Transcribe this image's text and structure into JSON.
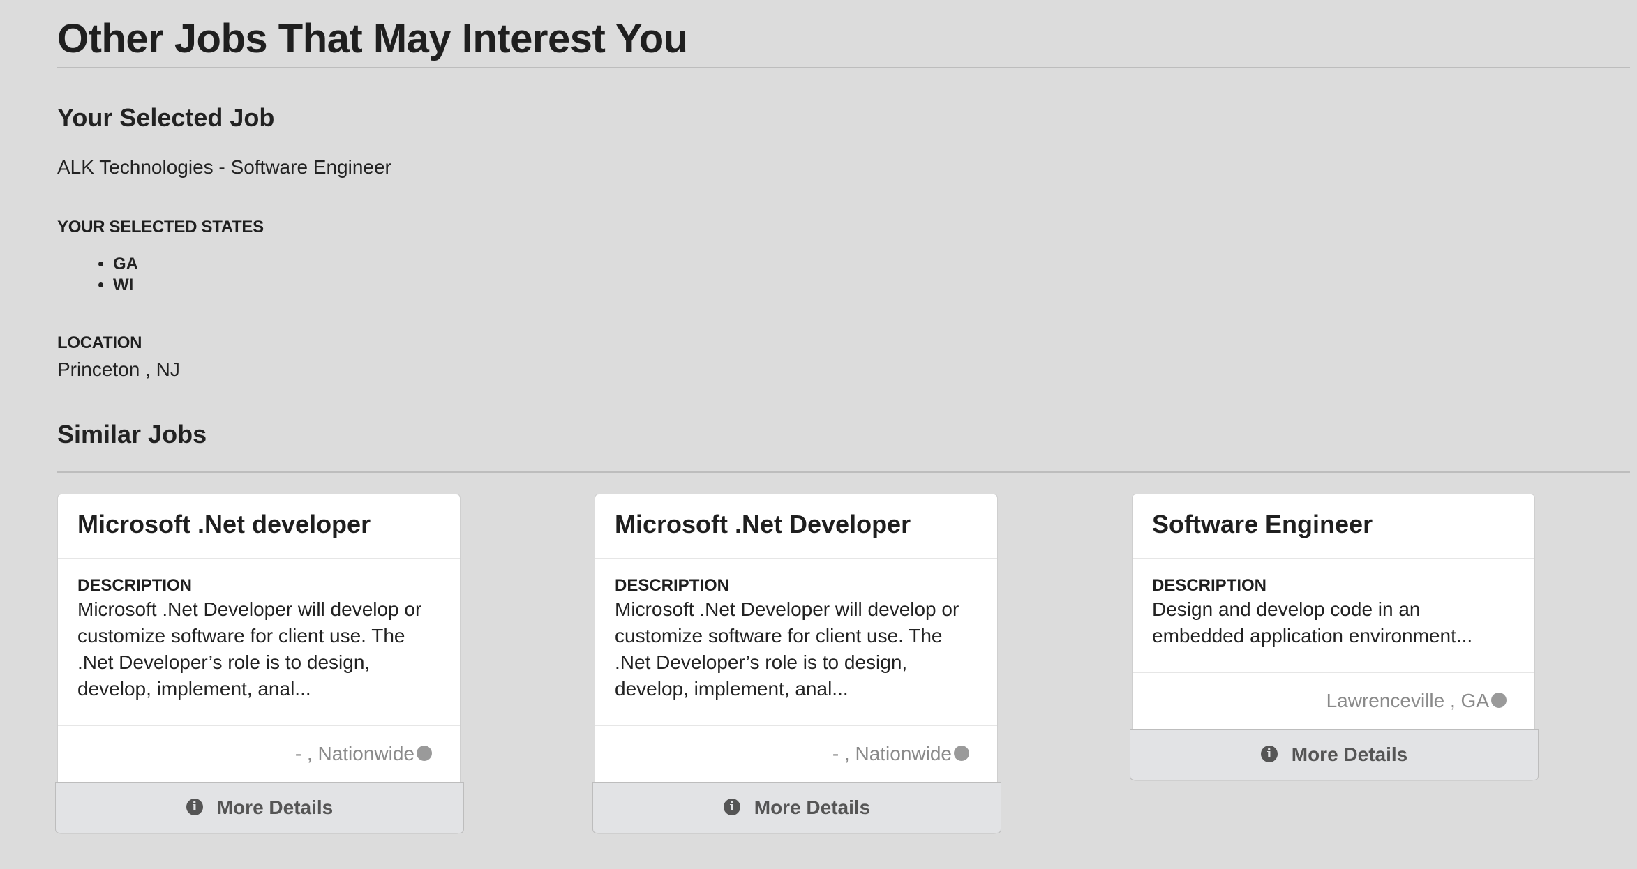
{
  "page": {
    "title": "Other Jobs That May Interest You"
  },
  "selected": {
    "heading": "Your Selected Job",
    "job": "ALK Technologies - Software Engineer",
    "states_label": "YOUR SELECTED STATES",
    "states": [
      "GA",
      "WI"
    ],
    "location_label": "LOCATION",
    "location": "Princeton , NJ"
  },
  "similar": {
    "heading": "Similar Jobs",
    "jobs": [
      {
        "title": "Microsoft .Net developer",
        "description_label": "DESCRIPTION",
        "description": "Microsoft .Net Developer will develop or customize software for client use. The .Net Developer’s role is to design, develop, implement, anal...",
        "location": "- , Nationwide",
        "location_icon": "globe-icon",
        "button_label": "More Details",
        "button_icon": "info-icon"
      },
      {
        "title": "Microsoft .Net Developer",
        "description_label": "DESCRIPTION",
        "description": "Microsoft .Net Developer will develop or customize software for client use. The .Net Developer’s role is to design, develop, implement, anal...",
        "location": "- , Nationwide",
        "location_icon": "globe-icon",
        "button_label": "More Details",
        "button_icon": "info-icon"
      },
      {
        "title": "Software Engineer",
        "description_label": "DESCRIPTION",
        "description": "Design and develop code in an embedded application environment...",
        "location": "Lawrenceville , GA",
        "location_icon": "globe-icon",
        "button_label": "More Details",
        "button_icon": "info-icon"
      }
    ]
  },
  "colors": {
    "background": "#dcdcdc",
    "card": "#ffffff",
    "button": "#e2e3e5",
    "muted_text": "#8a8a8a"
  }
}
